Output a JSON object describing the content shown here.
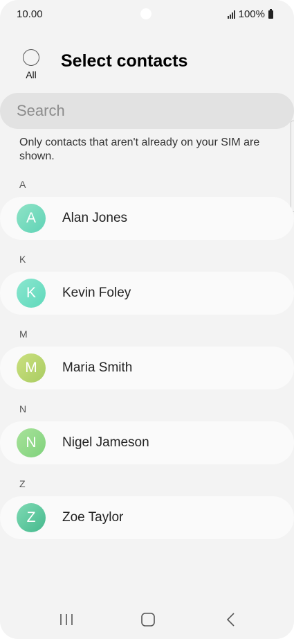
{
  "status_bar": {
    "time": "10.00",
    "battery": "100%",
    "icons": [
      "signal-icon",
      "battery-icon"
    ]
  },
  "header": {
    "select_all_label": "All",
    "title": "Select contacts"
  },
  "search": {
    "placeholder": "Search"
  },
  "notice": "Only contacts that aren't already on your SIM are shown.",
  "sections": [
    {
      "letter": "A",
      "contact": {
        "name": "Alan Jones",
        "initial": "A",
        "avatar_color": "#6fd9b9"
      }
    },
    {
      "letter": "K",
      "contact": {
        "name": "Kevin Foley",
        "initial": "K",
        "avatar_color": "#6fdec0"
      }
    },
    {
      "letter": "M",
      "contact": {
        "name": "Maria Smith",
        "initial": "M",
        "avatar_color": "#b9d46f"
      }
    },
    {
      "letter": "N",
      "contact": {
        "name": "Nigel Jameson",
        "initial": "N",
        "avatar_color": "#8fd88a"
      }
    },
    {
      "letter": "Z",
      "contact": {
        "name": "Zoe Taylor",
        "initial": "Z",
        "avatar_color": "#5cc99f"
      }
    }
  ],
  "nav_bar": {
    "icons": [
      "recents-icon",
      "home-icon",
      "back-icon"
    ]
  }
}
